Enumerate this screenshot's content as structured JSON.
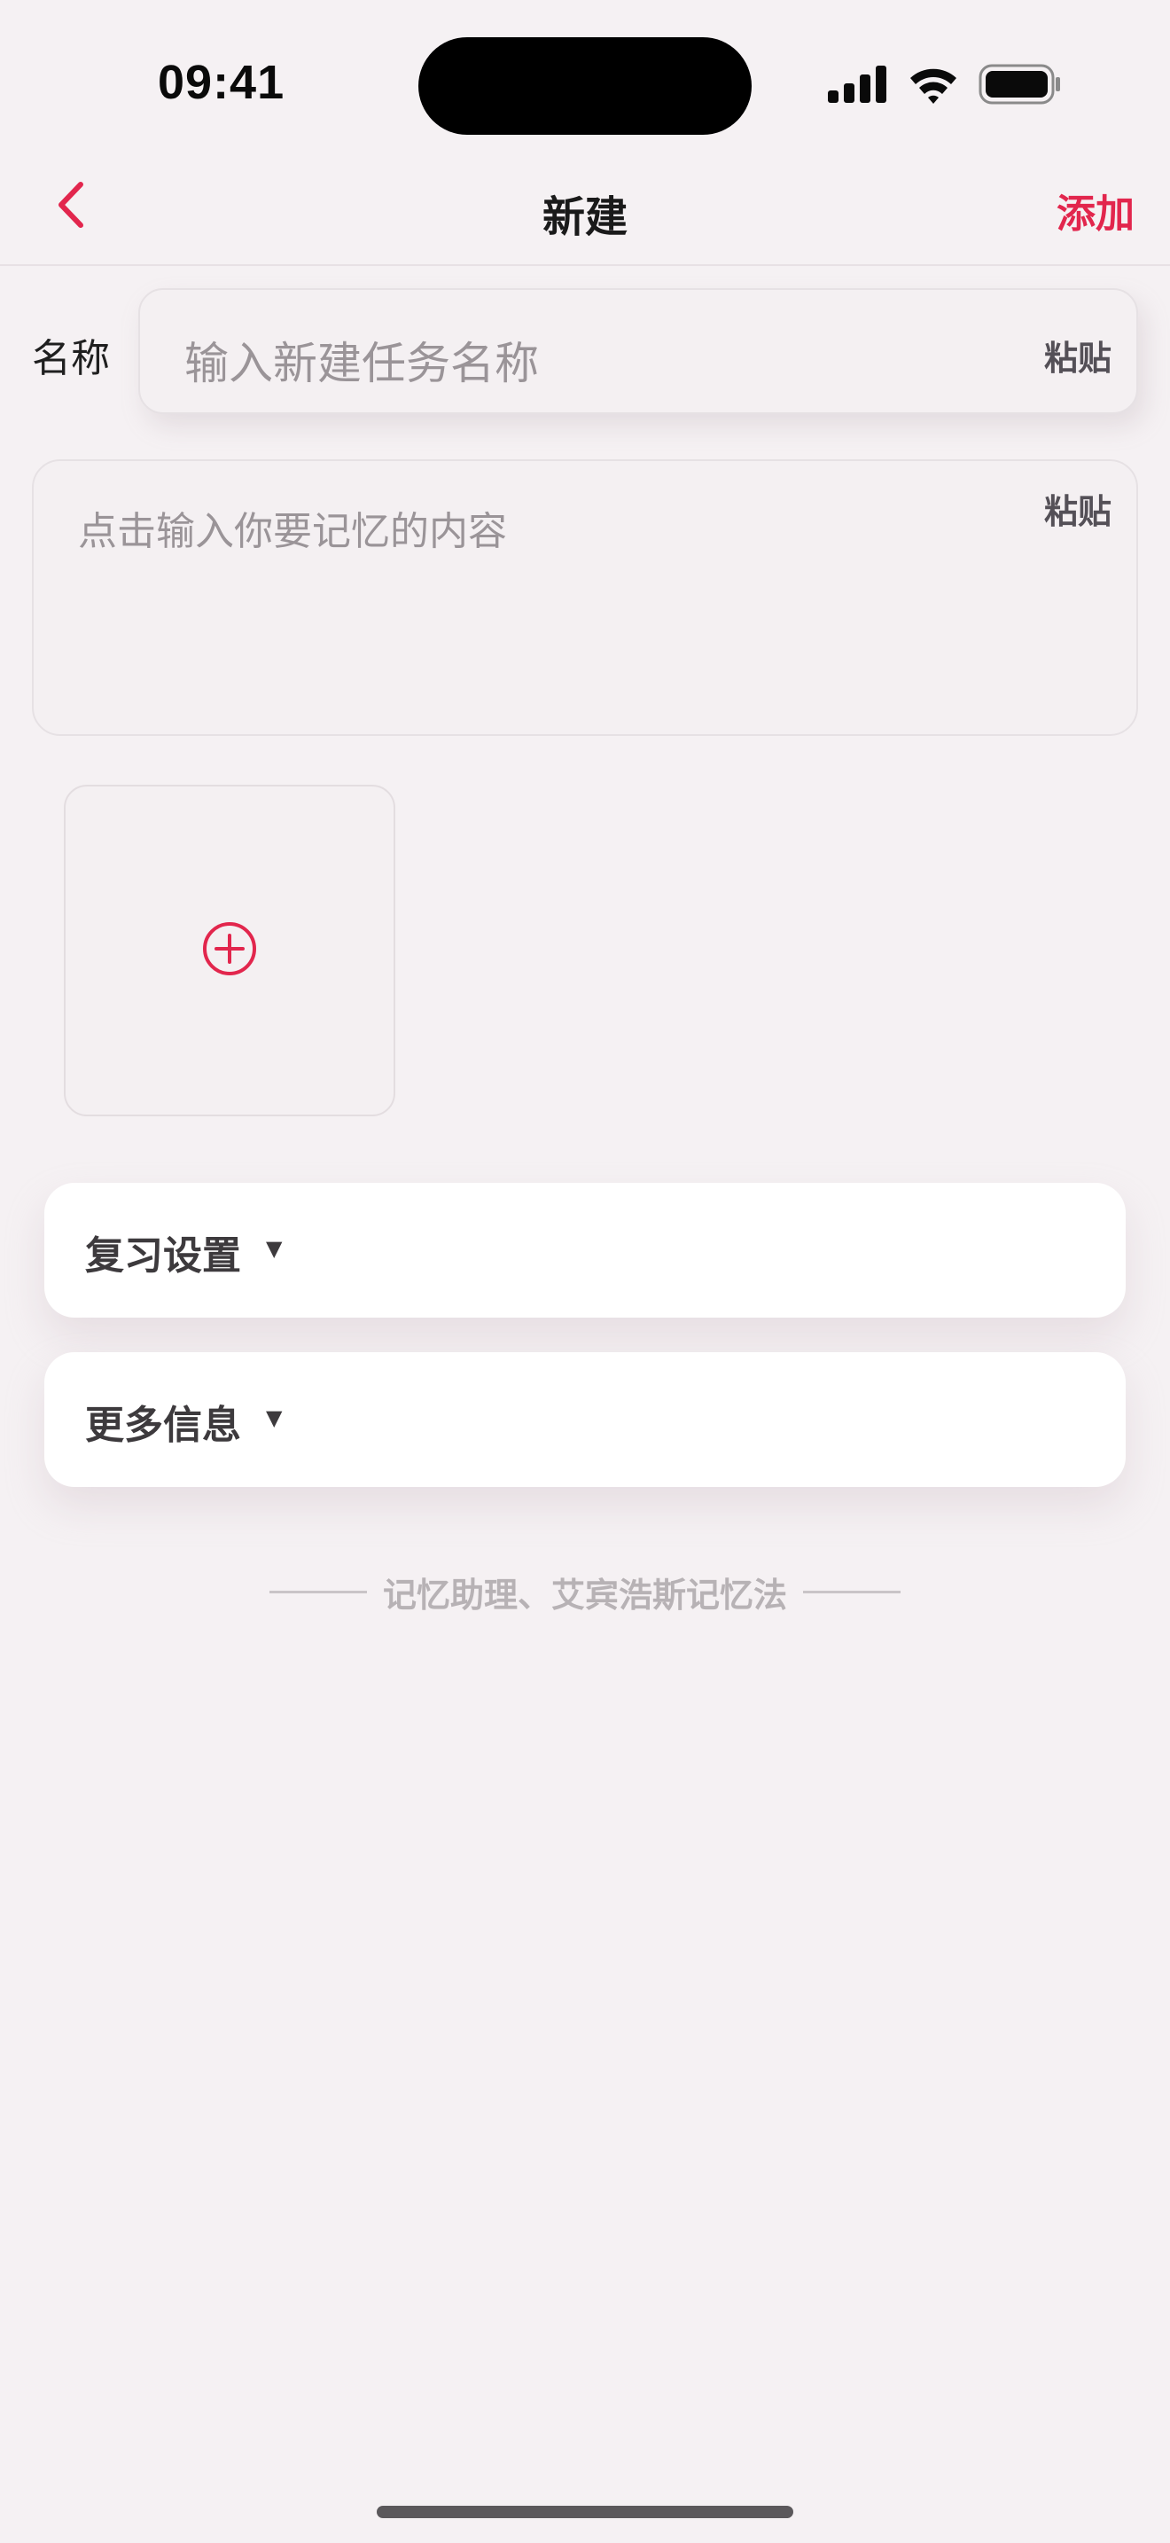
{
  "status_bar": {
    "time": "09:41"
  },
  "nav": {
    "title": "新建",
    "add_label": "添加",
    "accent_color": "#e2264d"
  },
  "form": {
    "name_label": "名称",
    "name_placeholder": "输入新建任务名称",
    "name_value": "",
    "paste_label": "粘贴",
    "content_placeholder": "点击输入你要记忆的内容",
    "content_value": ""
  },
  "sections": [
    {
      "label": "复习设置",
      "caret": "▼"
    },
    {
      "label": "更多信息",
      "caret": "▼"
    }
  ],
  "footer": {
    "text": "记忆助理、艾宾浩斯记忆法"
  },
  "icons": {
    "back": "chevron-left-icon",
    "add_image": "plus-circle-icon",
    "signal": "cellular-signal-icon",
    "wifi": "wifi-icon",
    "battery": "battery-icon"
  }
}
